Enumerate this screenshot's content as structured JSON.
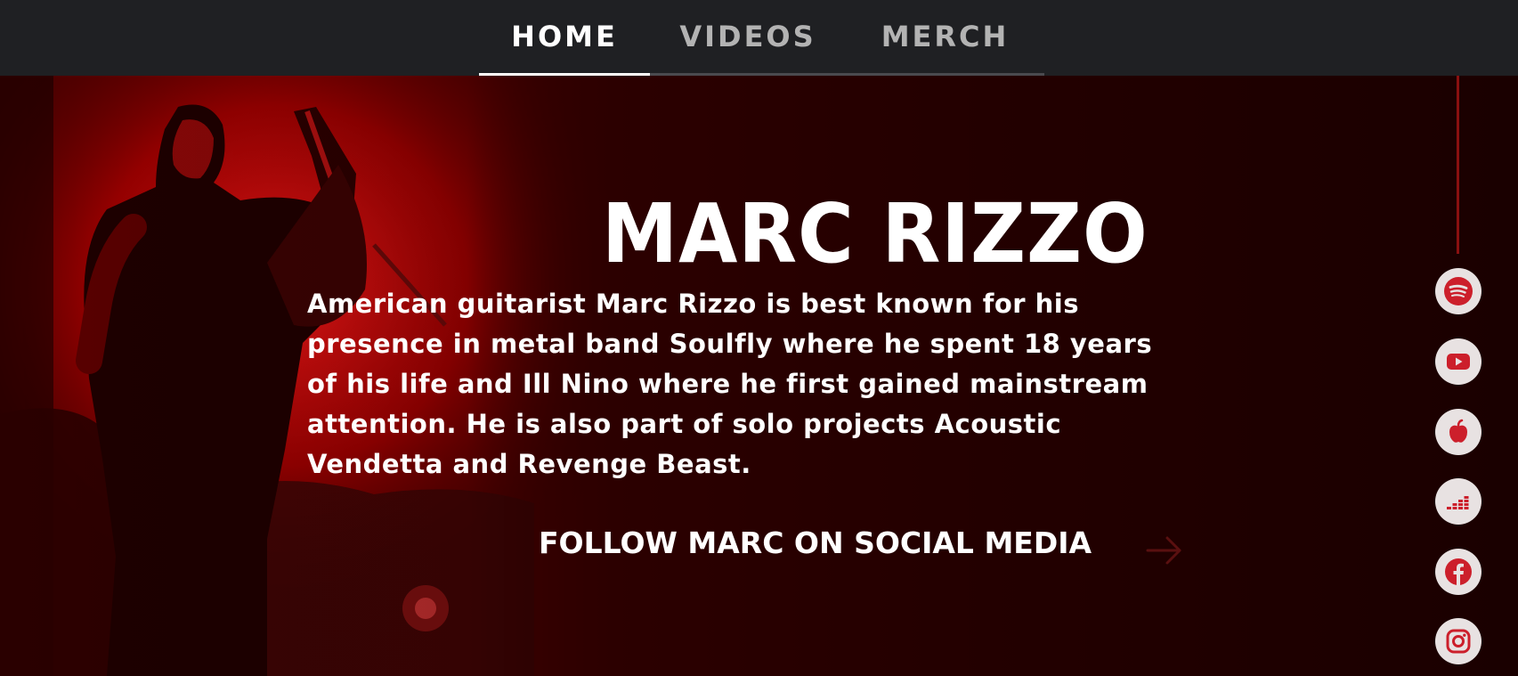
{
  "nav": {
    "tabs": [
      {
        "label": "HOME",
        "active": true
      },
      {
        "label": "VIDEOS",
        "active": false
      },
      {
        "label": "MERCH",
        "active": false
      }
    ]
  },
  "hero": {
    "title": "MARC RIZZO",
    "bio_lines": [
      "American guitarist Marc Rizzo is best known for his",
      "presence in metal band Soulfly where he spent 18 years",
      "of his life and Ill Nino where he first gained mainstream",
      "attention. He is also part of solo projects Acoustic",
      "Vendetta and Revenge Beast."
    ],
    "follow_label": "FOLLOW MARC ON SOCIAL MEDIA",
    "follow_icon": "arrow-right-icon"
  },
  "social": [
    {
      "name": "spotify-icon"
    },
    {
      "name": "youtube-icon"
    },
    {
      "name": "apple-icon"
    },
    {
      "name": "deezer-icon"
    },
    {
      "name": "facebook-icon"
    },
    {
      "name": "instagram-icon"
    }
  ],
  "colors": {
    "nav_bg": "#1f2023",
    "accent_red": "#cc1f2b",
    "hero_dark": "#230000",
    "text": "#ffffff"
  }
}
